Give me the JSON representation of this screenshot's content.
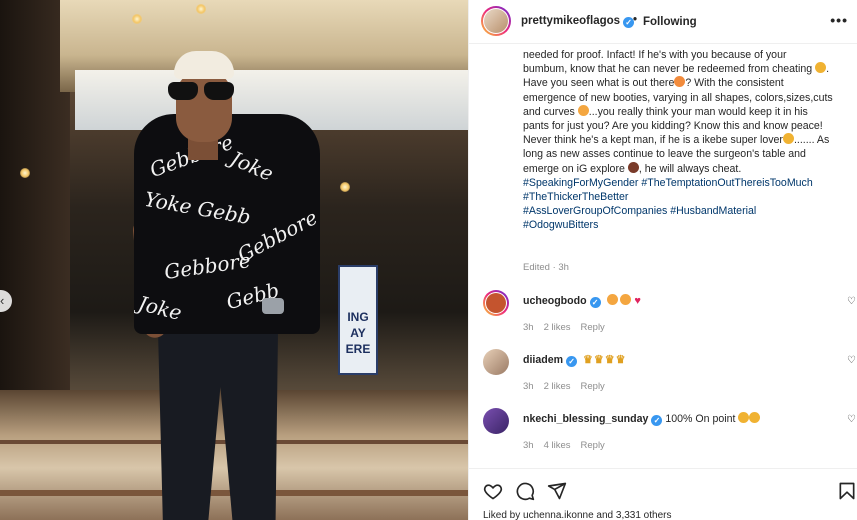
{
  "post": {
    "username": "prettymikeoflagos",
    "verified_mark": "✓",
    "separator": "•",
    "follow_status": "Following",
    "more_label": "•••",
    "caption_lines": [
      "needed for proof. Infact! If he's with you because of your",
      "bumbum, know that he can never be redeemed from cheating",
      "Have you seen what is out there",
      "? With the consistent",
      "emergence of new booties, varying in all shapes, colors,sizes,cuts",
      "and curves",
      "...you really think your man would keep it in his",
      "pants for just you? Are you kidding? Know this and know peace!",
      "Never think he's a kept man, if he is a ikebe super lover",
      "....... As",
      "long as new asses continue to leave the surgeon's table and",
      "emerge on iG explore",
      ", he will always cheat."
    ],
    "hashtags": [
      "#SpeakingForMyGender",
      "#TheTemptationOutThereisTooMuch",
      "#TheThickerTheBetter",
      "#AssLoverGroupOfCompanies",
      "#HusbandMaterial",
      "#OdogwuBitters"
    ],
    "edited_label": "Edited",
    "edited_time": "3h"
  },
  "comments": [
    {
      "username": "ucheogbodo",
      "text": "",
      "time": "3h",
      "likes": "2 likes",
      "reply": "Reply",
      "avatar_color": "#c4542e",
      "emoji_colors": [
        "#f4a640",
        "#f4a640",
        "#e0245e"
      ]
    },
    {
      "username": "diiadem",
      "text": "",
      "time": "3h",
      "likes": "2 likes",
      "reply": "Reply",
      "avatar_color": "#b89b84",
      "emoji_colors": [
        "#f0b232",
        "#f0b232",
        "#f0b232",
        "#f0b232"
      ]
    },
    {
      "username": "nkechi_blessing_sunday",
      "text": "100% On point",
      "time": "3h",
      "likes": "4 likes",
      "reply": "Reply",
      "avatar_color": "#5a3b8c",
      "emoji_colors": [
        "#f0b232",
        "#f0b232"
      ]
    }
  ],
  "photo": {
    "sign_text": "ING\nAY\nERE"
  },
  "footer": {
    "likes_text": "Liked by uchenna.ikonne and 3,331 others"
  },
  "colors": {
    "verified": "#3897f0",
    "hashtag": "#00376b",
    "muted": "#8e8e8e"
  },
  "icons": [
    "heart-icon",
    "comment-icon",
    "share-icon",
    "bookmark-icon",
    "more-icon",
    "chevron-left-icon"
  ]
}
